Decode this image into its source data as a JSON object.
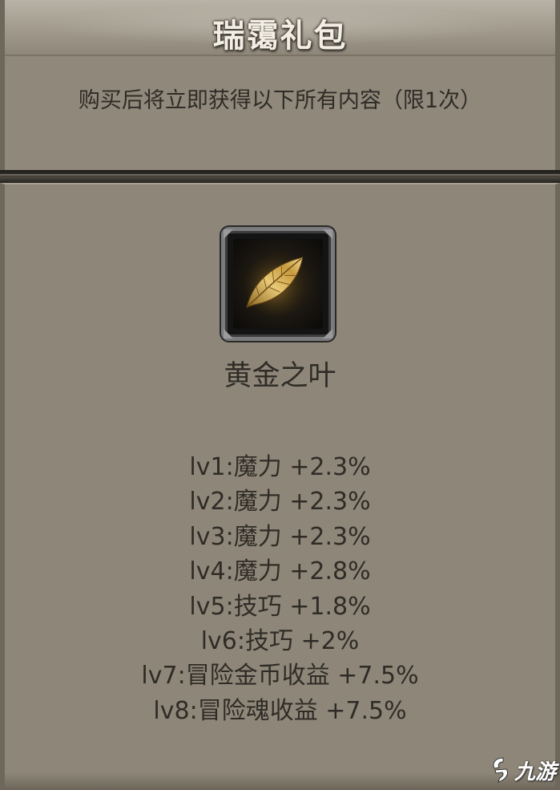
{
  "header": {
    "title": "瑞霭礼包",
    "subtitle": "购买后将立即获得以下所有内容（限1次）"
  },
  "item": {
    "icon": "golden-leaf-icon",
    "name": "黄金之叶",
    "stats": [
      "lv1:魔力 +2.3%",
      "lv2:魔力 +2.3%",
      "lv3:魔力 +2.3%",
      "lv4:魔力 +2.8%",
      "lv5:技巧 +1.8%",
      "lv6:技巧 +2%",
      "lv7:冒险金币收益 +7.5%",
      "lv8:冒险魂收益 +7.5%"
    ]
  },
  "watermark": {
    "text": "九游"
  },
  "colors": {
    "background": "#8d8577",
    "text": "#2f2b26",
    "title_text": "#f3eee4",
    "leaf_gold": "#d9b45a"
  }
}
